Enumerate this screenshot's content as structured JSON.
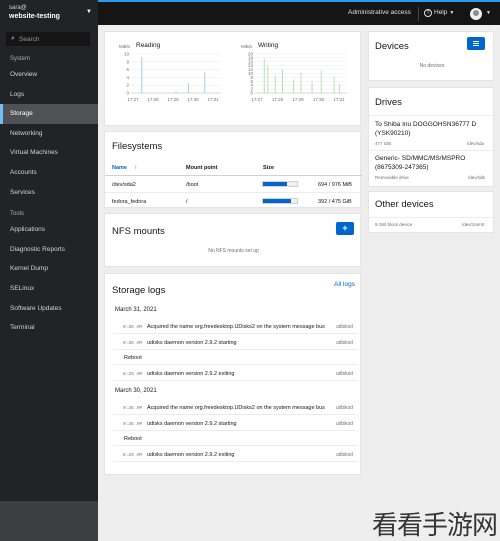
{
  "host": {
    "user": "sara@",
    "name": "website-testing"
  },
  "search": {
    "placeholder": "Search"
  },
  "sidebar": {
    "system_label": "System",
    "system_items": [
      "Overview",
      "Logs",
      "Storage",
      "Networking",
      "Virtual Machines",
      "Accounts",
      "Services"
    ],
    "active": "Storage",
    "tools_label": "Tools",
    "tool_items": [
      "Applications",
      "Diagnostic Reports",
      "Kernel Dump",
      "SELinux",
      "Software Updates",
      "Terminal"
    ]
  },
  "topbar": {
    "admin": "Administrative access",
    "help": "Help"
  },
  "io": {
    "unit": "MiB/s",
    "reading": {
      "label": "Reading",
      "yticks": [
        "10",
        "8",
        "6",
        "4",
        "2",
        "0"
      ],
      "xticks": [
        "17:27",
        "17:28",
        "17:29",
        "17:30",
        "17:31"
      ]
    },
    "writing": {
      "label": "Writing",
      "yticks": [
        "20",
        "18",
        "16",
        "14",
        "12",
        "10",
        "8",
        "6",
        "4",
        "2",
        "0"
      ],
      "xticks": [
        "17:27",
        "17:28",
        "17:29",
        "17:30",
        "17:31"
      ]
    }
  },
  "filesystems": {
    "title": "Filesystems",
    "columns": [
      "Name",
      "Mount point",
      "Size"
    ],
    "rows": [
      {
        "name": "/dev/sda2",
        "mount": "/boot",
        "used": "694 / 976 MiB",
        "fraction": 0.71
      },
      {
        "name": "fedora_fedora",
        "mount": "/",
        "used": "392 / 475 GiB",
        "fraction": 0.82
      }
    ]
  },
  "nfs": {
    "title": "NFS mounts",
    "empty": "No NFS mounts set up",
    "add": "+"
  },
  "logs": {
    "title": "Storage logs",
    "all_link": "All logs",
    "groups": [
      {
        "date": "March 31, 2021",
        "entries": [
          {
            "time": "9:36 AM",
            "msg": "Acquired the name org.freedesktop.UDisks2 on the system message bus",
            "src": "udisksd"
          },
          {
            "time": "9:36 AM",
            "msg": "udisks daemon version 2.9.2 starting",
            "src": "udisksd"
          },
          {
            "time": "",
            "msg": "Reboot",
            "src": ""
          },
          {
            "time": "8:25 AM",
            "msg": "udisks daemon version 2.9.2 exiting",
            "src": "udisksd"
          }
        ]
      },
      {
        "date": "March 30, 2021",
        "entries": [
          {
            "time": "9:36 AM",
            "msg": "Acquired the name org.freedesktop.UDisks2 on the system message bus",
            "src": "udisksd"
          },
          {
            "time": "9:36 AM",
            "msg": "udisks daemon version 2.9.2 starting",
            "src": "udisksd"
          },
          {
            "time": "",
            "msg": "Reboot",
            "src": ""
          },
          {
            "time": "8:25 AM",
            "msg": "udisks daemon version 2.9.2 exiting",
            "src": "udisksd"
          }
        ]
      }
    ]
  },
  "devices": {
    "title": "Devices",
    "empty": "No devices"
  },
  "drives": {
    "title": "Drives",
    "items": [
      {
        "name": "To Shiba Inu DOGGOHSN36777 D (YSK90210)",
        "size": "477 GiB",
        "dev": "/dev/sda"
      },
      {
        "name": "Generic- SD/MMC/MS/MSPRO (8675309-247365)",
        "size": "Removable drive",
        "dev": "/dev/sdb"
      }
    ]
  },
  "other_devices": {
    "title": "Other devices",
    "items": [
      {
        "name": "9 GiB block device",
        "dev": "/dev/zram0"
      }
    ]
  },
  "watermark": "看看手游网",
  "colors": {
    "accent": "#0066cc",
    "sidebar_bg": "#212427",
    "topbar_bg": "#151515",
    "active_indicator": "#73bcf7"
  }
}
